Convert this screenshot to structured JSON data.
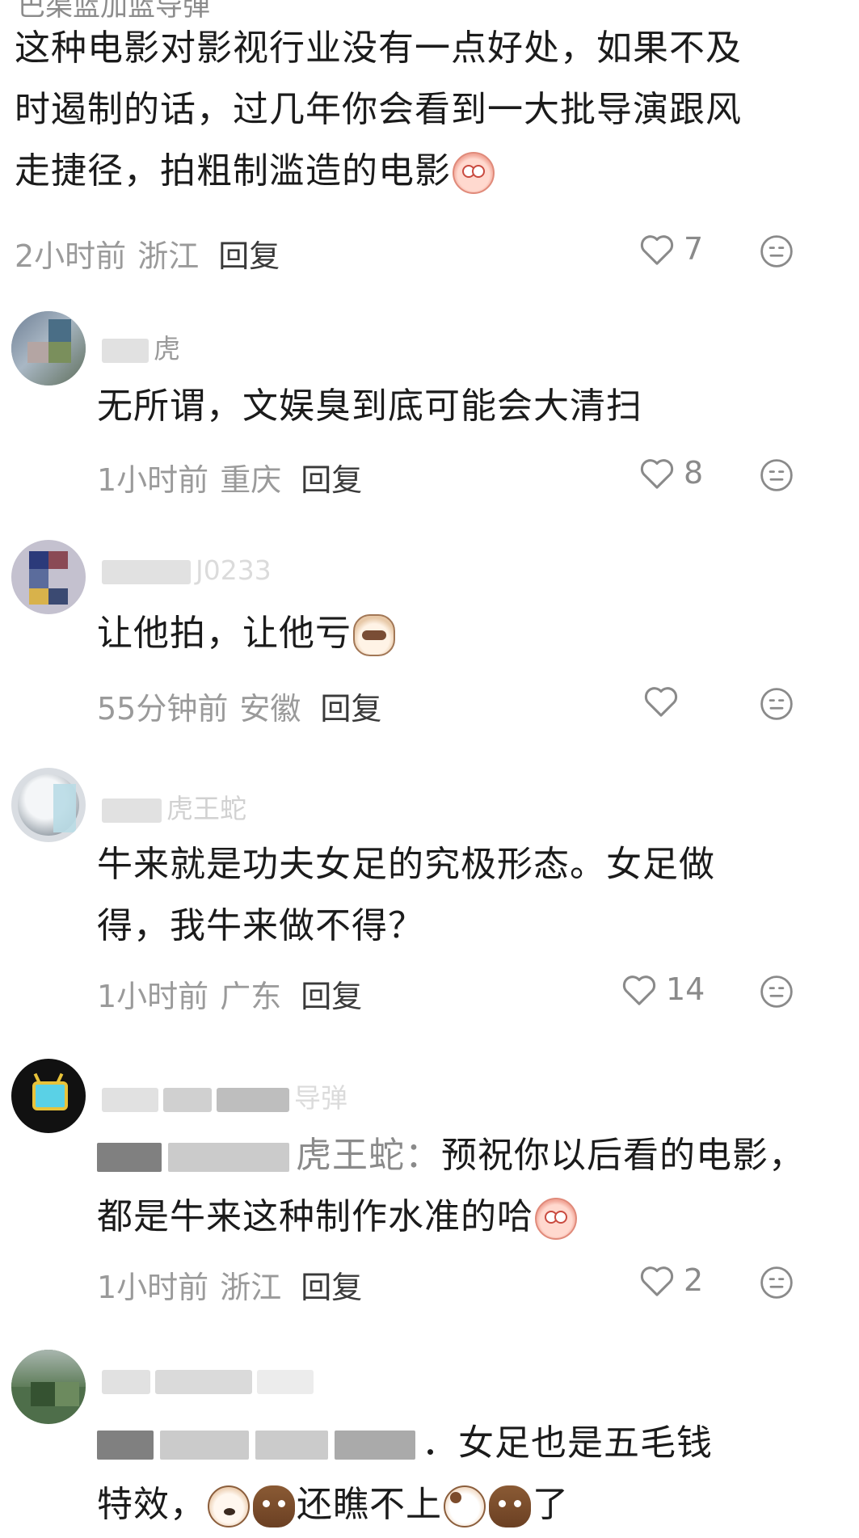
{
  "top_username": "巴渠蓝加蓝导弹",
  "comments": [
    {
      "text": "这种电影对影视行业没有一点好处，如果不及时遏制的话，过几年你会看到一大批导演跟风走捷径，拍粗制滥造的电影",
      "line1": "这种电影对影视行业没有一点好处，如果不及",
      "line2": "时遏制的话，过几年你会看到一大批导演跟风",
      "line3": "走捷径，拍粗制滥造的电影",
      "time": "2小时前",
      "region": "浙江",
      "reply": "回复",
      "likes": "7",
      "emoji": "peach"
    },
    {
      "username_suffix": "虎",
      "text": "无所谓，文娱臭到底可能会大清扫",
      "time": "1小时前",
      "region": "重庆",
      "reply": "回复",
      "likes": "8"
    },
    {
      "username_suffix": "J0233",
      "text": "让他拍，让他亏",
      "time": "55分钟前",
      "region": "安徽",
      "reply": "回复",
      "likes": "",
      "emoji": "cat"
    },
    {
      "username_suffix": "虎王蛇",
      "line1": "牛来就是功夫女足的究极形态。女足做",
      "line2": "得，我牛来做不得？",
      "time": "1小时前",
      "region": "广东",
      "reply": "回复",
      "likes": "14"
    },
    {
      "username_suffix": "导弹",
      "reply_prefix_tail": "虎王蛇：",
      "line1_tail": "预祝你以后看的电影，",
      "line2": "都是牛来这种制作水准的哈",
      "time": "1小时前",
      "region": "浙江",
      "reply": "回复",
      "likes": "2",
      "emoji": "peach"
    },
    {
      "line1_tail": "．女足也是五毛钱",
      "line2_a": "特效，",
      "line2_b": "还瞧不上",
      "line2_c": "了"
    }
  ],
  "colors": {
    "text": "#1b1b1b",
    "meta": "#9a9a9a",
    "reply": "#3a3a3a",
    "icon": "#8a8a8a"
  },
  "icons": [
    "heart-outline-icon",
    "neutral-face-icon"
  ]
}
